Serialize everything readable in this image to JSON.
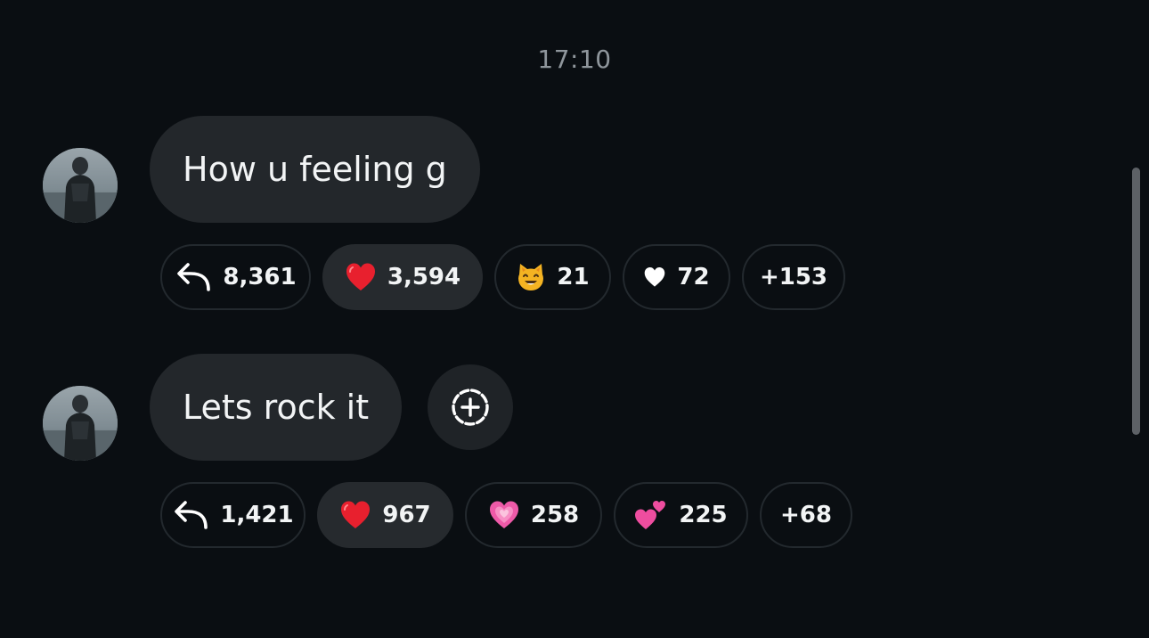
{
  "timestamp": "17:10",
  "messages": [
    {
      "text": "How u feeling g",
      "reactions": {
        "reply_count": "8,361",
        "items": [
          {
            "icon": "red-heart-emoji",
            "count": "3,594",
            "selected": true
          },
          {
            "icon": "grinning-cat-emoji",
            "count": "21",
            "selected": false
          },
          {
            "icon": "white-heart-icon",
            "count": "72",
            "selected": false
          }
        ],
        "more": "+153"
      }
    },
    {
      "text": "Lets rock it",
      "reactions": {
        "reply_count": "1,421",
        "items": [
          {
            "icon": "red-heart-emoji",
            "count": "967",
            "selected": true
          },
          {
            "icon": "growing-heart-emoji",
            "count": "258",
            "selected": false
          },
          {
            "icon": "two-hearts-emoji",
            "count": "225",
            "selected": false
          }
        ],
        "more": "+68"
      }
    }
  ],
  "colors": {
    "background": "#0a0e12",
    "bubble": "#23272b",
    "chip_border": "#23292e",
    "chip_filled": "#262a2e",
    "timestamp": "#8f969c",
    "text": "#f2f4f5",
    "heart_red": "#e8202e",
    "heart_pink": "#ee5aa8"
  }
}
